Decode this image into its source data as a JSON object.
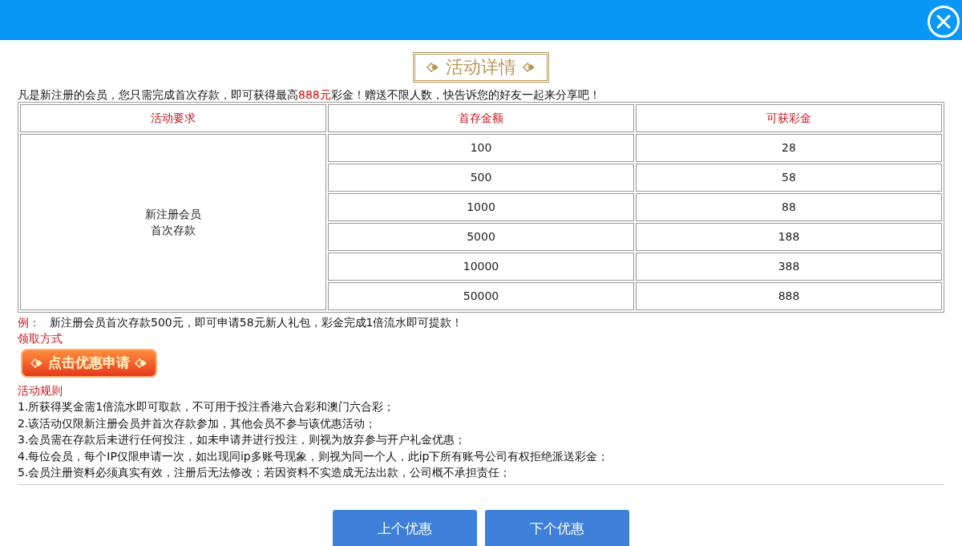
{
  "title": "活动详情",
  "intro": {
    "before": "凡是新注册的会员，您只需完成首次存款，即可获得最高",
    "highlight": "888元",
    "after": "彩金！赠送不限人数，快告诉您的好友一起来分享吧！"
  },
  "table": {
    "columns": [
      "活动要求",
      "首存金额",
      "可获彩金"
    ],
    "requirement": [
      "新注册会员",
      "首次存款"
    ],
    "rows": [
      {
        "deposit": "100",
        "bonus": "28"
      },
      {
        "deposit": "500",
        "bonus": "58"
      },
      {
        "deposit": "1000",
        "bonus": "88"
      },
      {
        "deposit": "5000",
        "bonus": "188"
      },
      {
        "deposit": "10000",
        "bonus": "388"
      },
      {
        "deposit": "50000",
        "bonus": "888"
      }
    ]
  },
  "example": {
    "label": "例：",
    "text": "新注册会员首次存款500元，即可申请58元新人礼包，彩金完成1倍流水即可提款！"
  },
  "claim": {
    "heading": "领取方式",
    "button": "点击优惠申请"
  },
  "rules": {
    "heading": "活动规则",
    "items": [
      "1.所获得奖金需1倍流水即可取款，不可用于投注香港六合彩和澳门六合彩；",
      "2.该活动仅限新注册会员并首次存款参加，其他会员不参与该优惠活动；",
      "3.会员需在存款后未进行任何投注，如未申请并进行投注，则视为放弃参与开户礼金优惠；",
      "4.每位会员，每个IP仅限申请一次，如出现同ip多账号现象，则视为同一个人，此ip下所有账号公司有权拒绝派送彩金；",
      "5.会员注册资料必须真实有效，注册后无法修改；若因资料不实造成无法出款，公司概不承担责任；"
    ]
  },
  "nav": [
    "上个优惠",
    "下个优惠"
  ]
}
